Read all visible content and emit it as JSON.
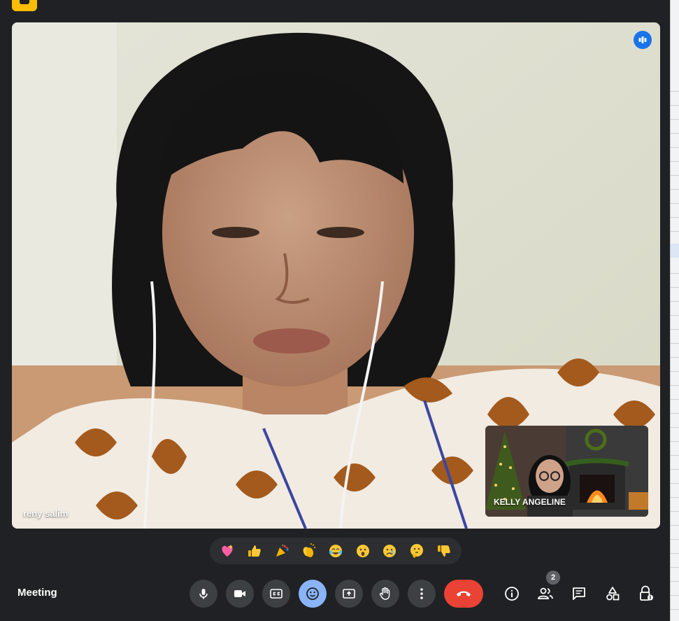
{
  "app": {
    "window_hint": "Google Meet"
  },
  "main_participant": {
    "name": "reny salim",
    "speaking": true
  },
  "self_view": {
    "name": "KELLY ANGELINE"
  },
  "reactions": [
    {
      "name": "sparkling-heart",
      "glyph": "💖"
    },
    {
      "name": "thumbs-up",
      "glyph": "👍"
    },
    {
      "name": "party-popper",
      "glyph": "🎉"
    },
    {
      "name": "clapping-hands",
      "glyph": "👏"
    },
    {
      "name": "tears-of-joy",
      "glyph": "😂"
    },
    {
      "name": "surprised",
      "glyph": "😮"
    },
    {
      "name": "crying",
      "glyph": "😢"
    },
    {
      "name": "thinking",
      "glyph": "🤔"
    },
    {
      "name": "thumbs-down",
      "glyph": "👎"
    }
  ],
  "controls": {
    "meeting_label": "Meeting",
    "buttons": [
      "microphone",
      "camera",
      "captions",
      "reactions",
      "present-screen",
      "raise-hand",
      "more-options",
      "leave-call"
    ],
    "side_buttons": [
      "meeting-details",
      "people",
      "chat",
      "activities",
      "host-controls"
    ],
    "participant_count": "2"
  },
  "colors": {
    "background": "#202124",
    "accent": "#8ab4f8",
    "end_call": "#ea4335",
    "speaking": "#1a73e8"
  }
}
